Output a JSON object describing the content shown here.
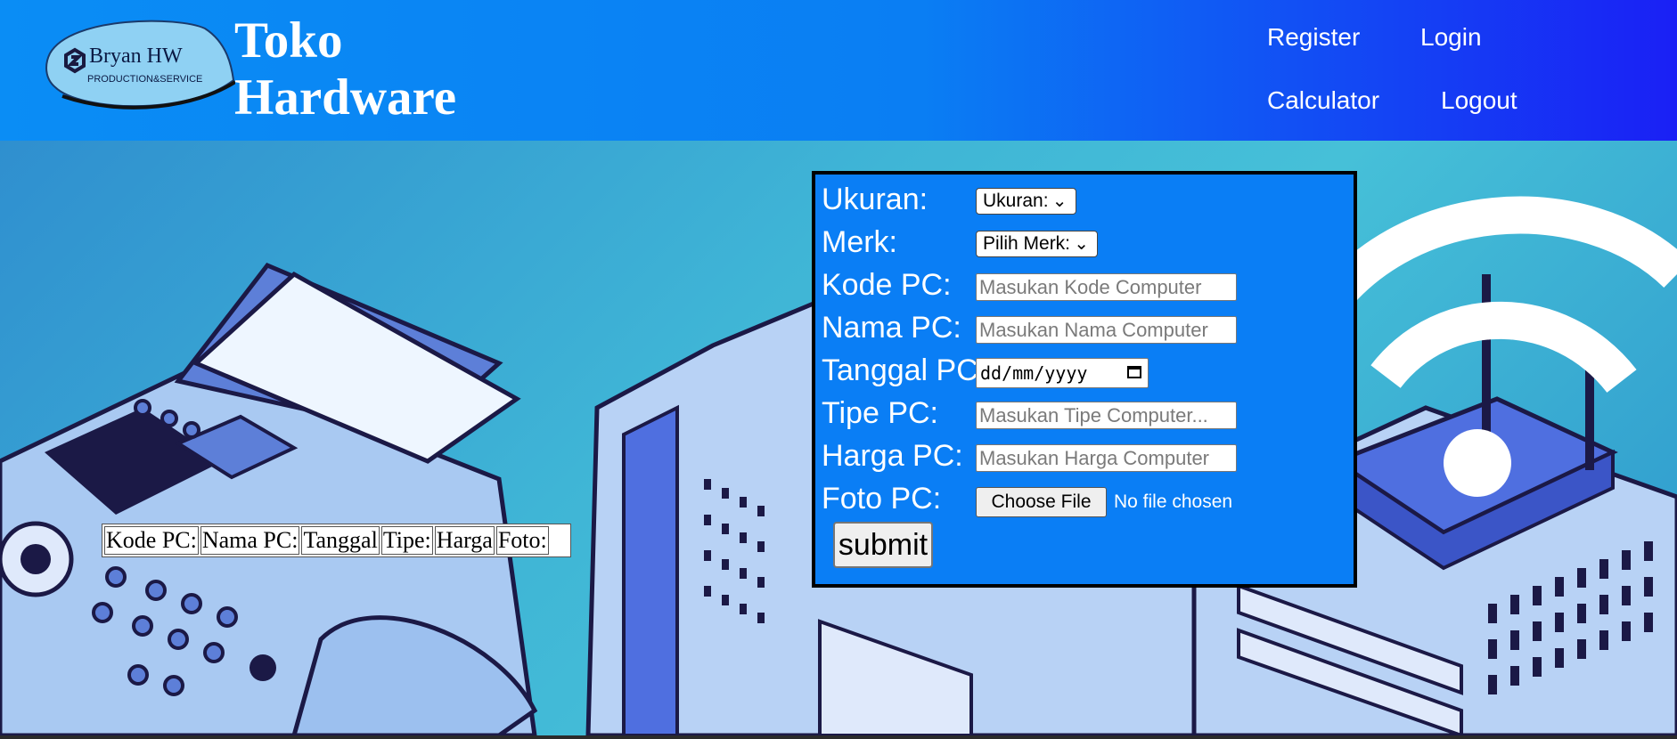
{
  "header": {
    "logo_text": "Bryan HW",
    "logo_subtext": "PRODUCTION&SERVICE",
    "brand_line1": "Toko",
    "brand_line2": "Hardware",
    "nav": {
      "register": "Register",
      "login": "Login",
      "calculator": "Calculator",
      "logout": "Logout"
    },
    "bg_color": "#0a7ef3"
  },
  "form": {
    "ukuran": {
      "label": "Ukuran:",
      "selected": "Ukuran:"
    },
    "merk": {
      "label": "Merk:",
      "selected": "Pilih Merk:"
    },
    "kode": {
      "label": "Kode PC:",
      "placeholder": "Masukan Kode Computer"
    },
    "nama": {
      "label": "Nama PC:",
      "placeholder": "Masukan Nama Computer"
    },
    "tanggal": {
      "label": "Tanggal PC:",
      "value": "dd/mm/yyyy"
    },
    "tipe": {
      "label": "Tipe PC:",
      "placeholder": "Masukan Tipe Computer..."
    },
    "harga": {
      "label": "Harga PC:",
      "placeholder": "Masukan Harga Computer"
    },
    "foto": {
      "label": "Foto PC:",
      "button": "Choose File",
      "status": "No file chosen"
    },
    "submit_label": "submit",
    "bg_color": "#0a7ef5"
  },
  "table": {
    "headers": [
      "Kode PC:",
      "Nama PC:",
      "Tanggal",
      "Tipe:",
      "Harga",
      "Foto:"
    ]
  }
}
